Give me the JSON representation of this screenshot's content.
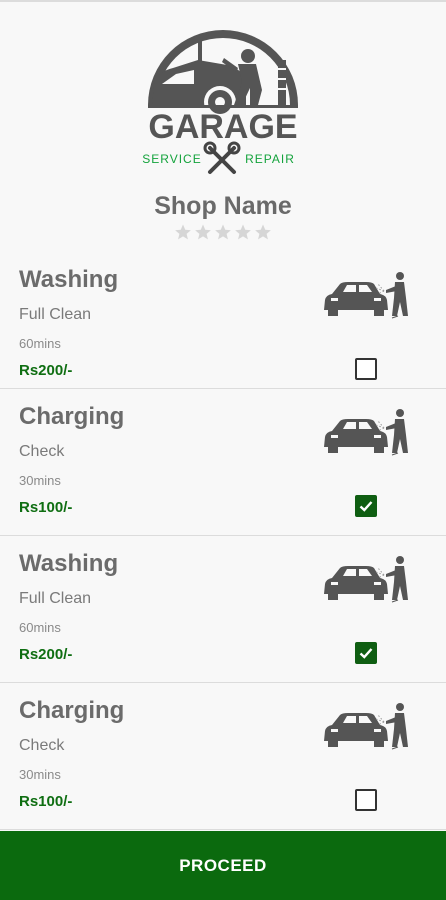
{
  "header": {
    "logo": {
      "icon": "garage-logo-icon",
      "title": "GARAGE",
      "left_text": "SERVICE",
      "right_text": "REPAIR",
      "brand_color": "#555555",
      "accent_color": "#14a33c"
    },
    "shop_name": "Shop Name",
    "rating": {
      "stars_filled": 0,
      "stars_total": 5
    }
  },
  "services": [
    {
      "title": "Washing",
      "subtitle": "Full Clean",
      "duration": "60mins",
      "price": "Rs200/-",
      "icon": "car-wash-icon",
      "checked": false
    },
    {
      "title": "Charging",
      "subtitle": "Check",
      "duration": "30mins",
      "price": "Rs100/-",
      "icon": "car-wash-icon",
      "checked": true
    },
    {
      "title": "Washing",
      "subtitle": "Full Clean",
      "duration": "60mins",
      "price": "Rs200/-",
      "icon": "car-wash-icon",
      "checked": true
    },
    {
      "title": "Charging",
      "subtitle": "Check",
      "duration": "30mins",
      "price": "Rs100/-",
      "icon": "car-wash-icon",
      "checked": false
    }
  ],
  "footer": {
    "proceed_label": "PROCEED"
  },
  "colors": {
    "primary_green": "#0b6a0e",
    "price_green": "#0f6e12",
    "text_gray": "#6b6b6b",
    "star_gray": "#d6d6d6"
  }
}
